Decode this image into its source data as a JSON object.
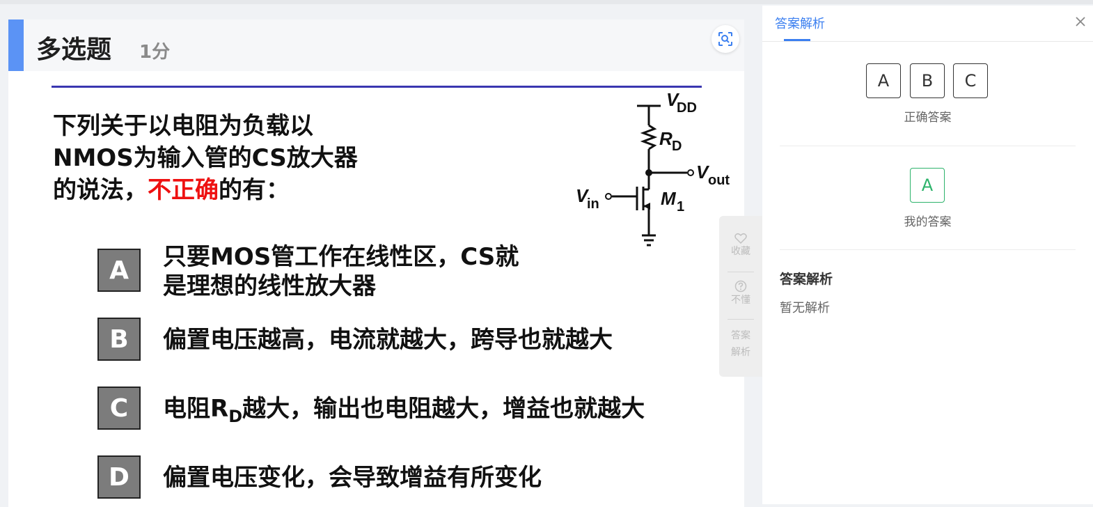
{
  "question": {
    "type": "多选题",
    "score": "1分",
    "stem_part1": "下列关于以电阻为负载以NMOS为输入管的CS放大器的说法，",
    "stem_highlight": "不正确",
    "stem_part3": "的有：",
    "options": [
      {
        "letter": "A",
        "text_line1": "只要MOS管工作在线性区，CS就",
        "text_line2": "是理想的线性放大器"
      },
      {
        "letter": "B",
        "text": "偏置电压越高，电流就越大，跨导也就越大"
      },
      {
        "letter": "C",
        "text_pre": "电阻R",
        "text_sub": "D",
        "text_post": "越大，输出也电阻越大，增益也就越大"
      },
      {
        "letter": "D",
        "text": "偏置电压变化，会导致增益有所变化"
      }
    ],
    "circuit": {
      "vdd": "V",
      "vdd_sub": "DD",
      "rd": "R",
      "rd_sub": "D",
      "vout": "V",
      "vout_sub": "out",
      "vin": "V",
      "vin_sub": "in",
      "m1": "M",
      "m1_sub": "1"
    }
  },
  "side_tools": [
    {
      "label": "收藏",
      "icon": "heart-icon"
    },
    {
      "label": "不懂",
      "icon": "question-circle-icon"
    },
    {
      "label_line1": "答案",
      "label_line2": "解析"
    }
  ],
  "answer_panel": {
    "tab": "答案解析",
    "correct_answers": [
      "A",
      "B",
      "C"
    ],
    "correct_label": "正确答案",
    "my_answers": [
      "A"
    ],
    "my_label": "我的答案",
    "analysis_title": "答案解析",
    "analysis_body": "暂无解析"
  },
  "colors": {
    "accent": "#5b93f5",
    "highlight": "#ee1111",
    "tab_blue": "#3b7ff0",
    "my_answer_green": "#2db36b"
  }
}
